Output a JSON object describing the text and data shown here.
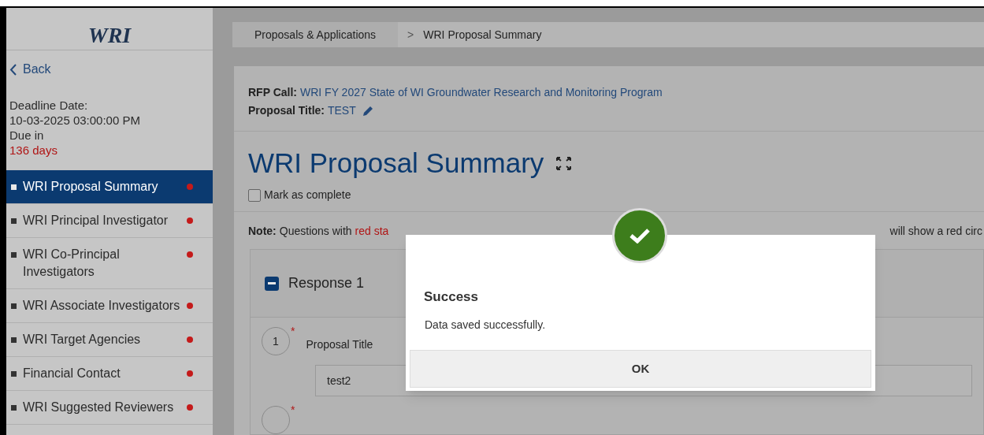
{
  "logo": {
    "text": "WRI"
  },
  "back": {
    "label": "Back"
  },
  "deadline": {
    "label": "Deadline Date:",
    "date": "10-03-2025 03:00:00 PM",
    "due_label": "Due in",
    "due_value": "136 days"
  },
  "sidebar": {
    "items": [
      {
        "label": "WRI Proposal Summary",
        "selected": true,
        "incomplete": true
      },
      {
        "label": "WRI Principal Investigator",
        "selected": false,
        "incomplete": true
      },
      {
        "label": "WRI Co-Principal Investigators",
        "selected": false,
        "incomplete": true
      },
      {
        "label": "WRI Associate Investigators",
        "selected": false,
        "incomplete": true
      },
      {
        "label": "WRI Target Agencies",
        "selected": false,
        "incomplete": true
      },
      {
        "label": "Financial Contact",
        "selected": false,
        "incomplete": true
      },
      {
        "label": "WRI Suggested Reviewers",
        "selected": false,
        "incomplete": true
      }
    ]
  },
  "breadcrumb": {
    "items": [
      {
        "label": "Proposals & Applications"
      },
      {
        "label": "WRI Proposal Summary"
      }
    ],
    "separator": ">"
  },
  "header": {
    "rfp_label": "RFP Call:",
    "rfp_value": "WRI FY 2027 State of WI Groundwater Research and Monitoring Program",
    "title_label": "Proposal Title:",
    "title_value": "TEST"
  },
  "page_title": "WRI Proposal Summary",
  "mark_complete": {
    "label": "Mark as complete",
    "checked": false
  },
  "note": {
    "label": "Note:",
    "start": "Questions with",
    "red": "red sta",
    "end": "will show a red circ"
  },
  "response": {
    "title": "Response 1",
    "expanded": true,
    "questions": [
      {
        "number": "1",
        "required_mark": "*",
        "label": "Proposal Title",
        "value": "test2"
      },
      {
        "required_mark": "*"
      }
    ]
  },
  "dialog": {
    "title": "Success",
    "message": "Data saved successfully.",
    "button": "OK"
  }
}
